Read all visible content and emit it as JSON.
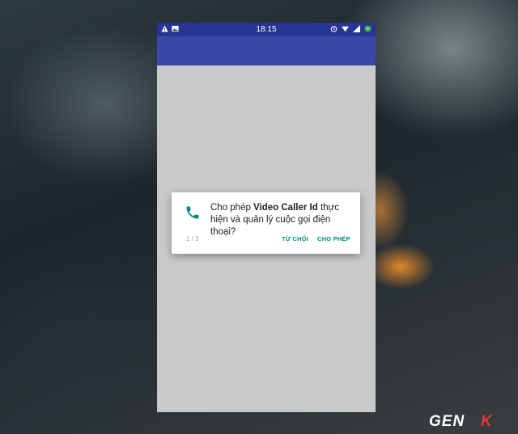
{
  "status_bar": {
    "time": "18:15",
    "left_icons": [
      "warning-icon",
      "image-icon"
    ],
    "right_icons": [
      "alarm-icon",
      "wifi-icon",
      "signal-icon",
      "battery-icon"
    ]
  },
  "dialog": {
    "message_prefix": "Cho phép ",
    "app_name": "Video Caller Id",
    "message_suffix": " thực hiện và quản lý cuộc gọi điện thoại?",
    "counter": "1 / 3",
    "deny_label": "TỪ CHỐI",
    "allow_label": "CHO PHÉP",
    "icon": "phone-icon",
    "accent_color": "#00897b"
  },
  "colors": {
    "status_bar": "#283593",
    "app_bar": "#3a49a6",
    "screen_background": "#c9c9c9"
  },
  "watermark": {
    "text": "GENK"
  }
}
